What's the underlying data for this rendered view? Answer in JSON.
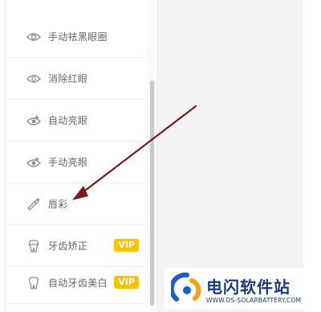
{
  "menu": {
    "items": [
      {
        "label": "手动祛黑眼圈",
        "icon": "eye-icon"
      },
      {
        "label": "消除红眼",
        "icon": "eye-outline-icon"
      },
      {
        "label": "自动亮眼",
        "icon": "eye-sparkle-icon"
      },
      {
        "label": "手动亮眼",
        "icon": "eye-sparkle-icon"
      },
      {
        "label": "唇彩",
        "icon": "lipstick-icon"
      },
      {
        "label": "牙齿矫正",
        "icon": "tooth-brace-icon",
        "badge": "VIP"
      },
      {
        "label": "自动牙齿美白",
        "icon": "tooth-icon",
        "badge": "VIP"
      }
    ]
  },
  "watermark": {
    "title": "电闪软件站",
    "url": "WWW.DS-SOLARBATTERY.COM"
  },
  "colors": {
    "badge": "#f8c400",
    "arrow": "#7a1a1a",
    "text": "#666666",
    "icon": "#8a8fa3",
    "right_pane": "#f3f3f5"
  }
}
